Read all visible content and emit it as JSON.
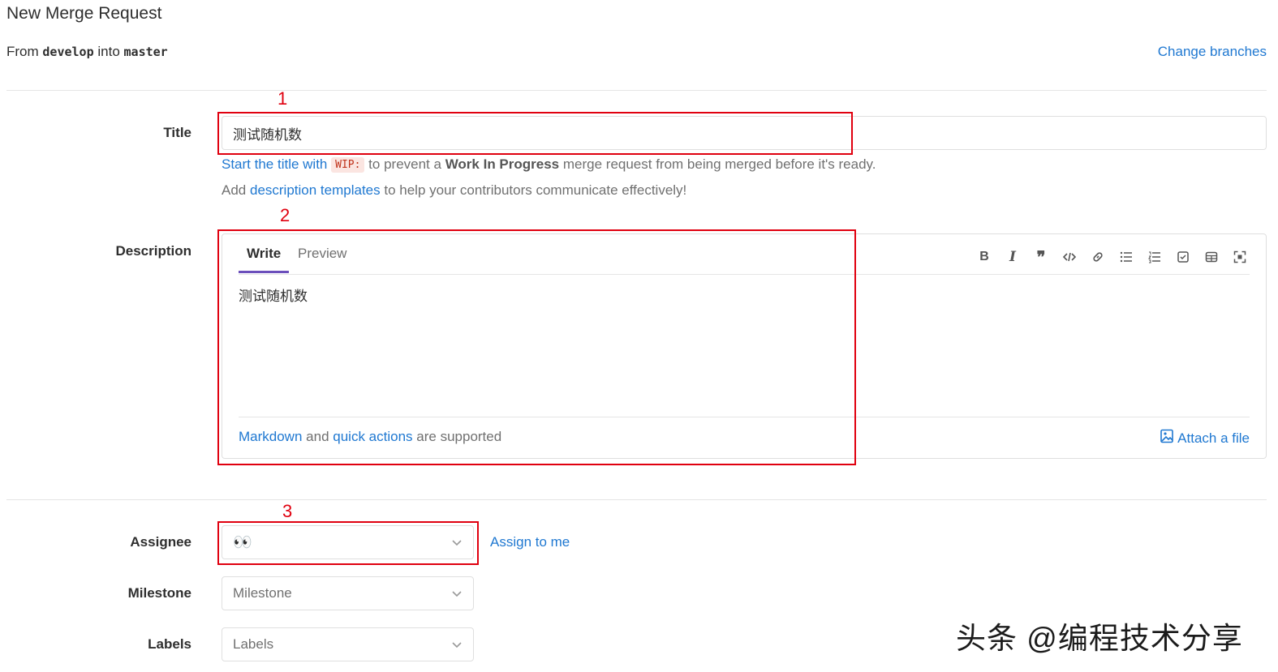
{
  "header": {
    "title": "New Merge Request",
    "from_prefix": "From",
    "source_branch": "develop",
    "into_word": "into",
    "target_branch": "master",
    "change_branches": "Change branches"
  },
  "title_field": {
    "label": "Title",
    "value": "测试随机数",
    "hint_link": "Start the title with",
    "hint_code": "WIP:",
    "hint_mid": "to prevent a",
    "hint_bold": "Work In Progress",
    "hint_end": "merge request from being merged before it's ready.",
    "templates_pre": "Add",
    "templates_link": "description templates",
    "templates_post": "to help your contributors communicate effectively!"
  },
  "description": {
    "label": "Description",
    "tabs": [
      "Write",
      "Preview"
    ],
    "value": "测试随机数",
    "toolbar": [
      "bold-icon",
      "italic-icon",
      "quote-icon",
      "code-icon",
      "link-icon",
      "bullet-list-icon",
      "numbered-list-icon",
      "task-list-icon",
      "table-icon",
      "fullscreen-icon"
    ],
    "footer_link1": "Markdown",
    "footer_and": "and",
    "footer_link2": "quick actions",
    "footer_end": "are supported",
    "attach": "Attach a file"
  },
  "assignee": {
    "label": "Assignee",
    "value": "👀",
    "assign_me": "Assign to me"
  },
  "milestone": {
    "label": "Milestone",
    "placeholder": "Milestone"
  },
  "labels": {
    "label": "Labels",
    "placeholder": "Labels"
  },
  "annotations": {
    "n1": "1",
    "n2": "2",
    "n3": "3",
    "color": "#e0000f"
  },
  "watermark": "头条 @编程技术分享",
  "colors": {
    "link": "#1f78d1",
    "active_tab": "#6b4fbb"
  }
}
